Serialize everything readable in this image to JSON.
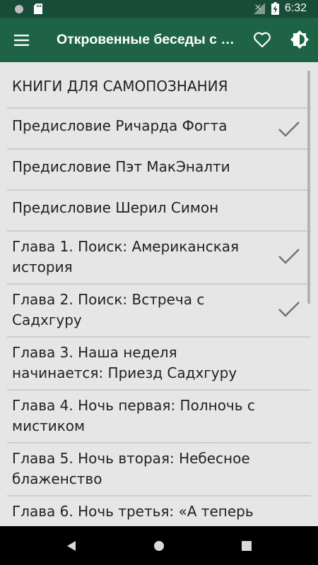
{
  "status_bar": {
    "time": "6:32",
    "icons": [
      "notification-dot-icon",
      "sd-card-icon",
      "signal-icon",
      "battery-charging-icon"
    ]
  },
  "app_bar": {
    "title": "Откровенные беседы с мистиком",
    "icons": [
      "menu-icon",
      "heart-icon",
      "brightness-icon"
    ]
  },
  "list": {
    "items": [
      {
        "label": "КНИГИ ДЛЯ САМОПОЗНАНИЯ",
        "checked": false
      },
      {
        "label": "Предисловие Ричарда Фогта",
        "checked": true
      },
      {
        "label": "Предисловие Пэт МакЭналти",
        "checked": false
      },
      {
        "label": "Предисловие Шерил Симон",
        "checked": false
      },
      {
        "label": "Глава 1. Поиск: Американская история",
        "checked": true
      },
      {
        "label": "Глава 2. Поиск: Встреча с Садхгуру",
        "checked": true
      },
      {
        "label": "Глава 3. Наша неделя начинается: Приезд Садхгуру",
        "checked": false
      },
      {
        "label": "Глава 4. Ночь первая: Полночь с мистиком",
        "checked": false
      },
      {
        "label": "Глава 5. Ночь вторая: Небесное блаженство",
        "checked": false
      },
      {
        "label": "Глава 6. Ночь третья: «А теперь",
        "checked": false
      }
    ]
  },
  "nav_bar": {
    "icons": [
      "back-icon",
      "home-icon",
      "recents-icon"
    ]
  },
  "colors": {
    "status_bar": "#164c38",
    "app_bar": "#1e6346",
    "list_background": "#e6e6e6",
    "divider": "#cdcdcd",
    "check": "#757575"
  }
}
